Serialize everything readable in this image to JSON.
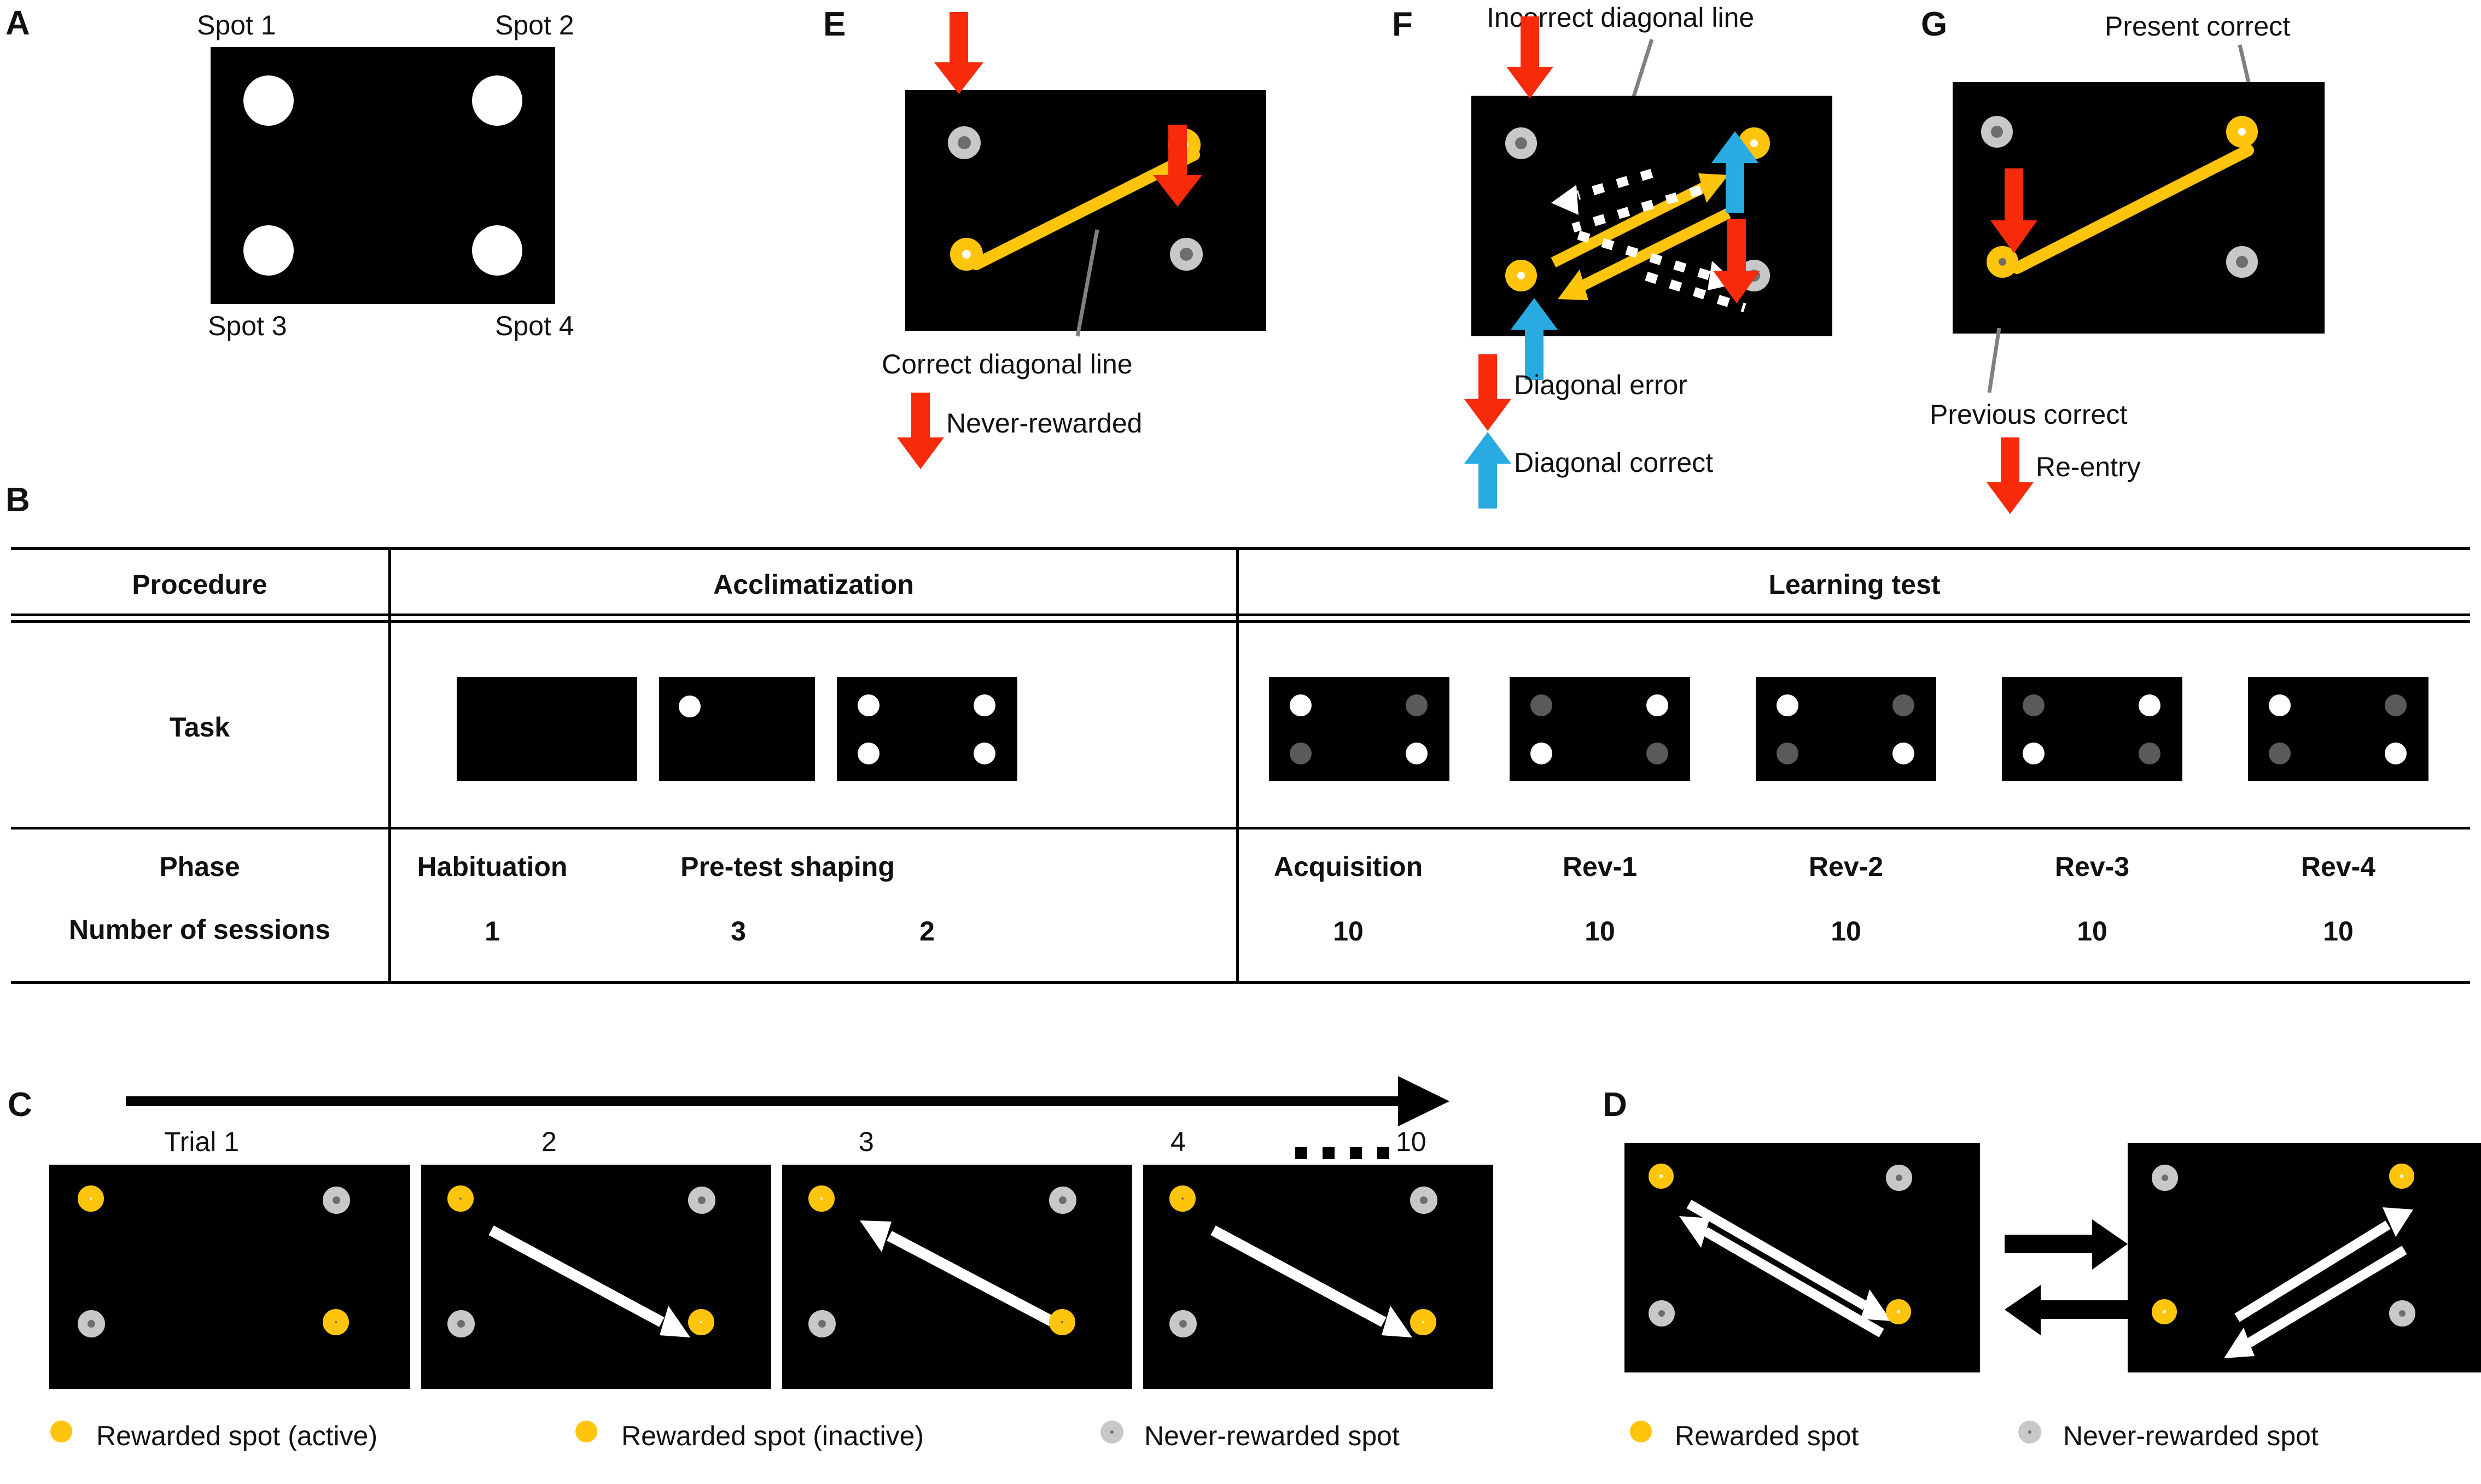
{
  "figure": {
    "panels": [
      "A",
      "B",
      "C",
      "D",
      "E",
      "F",
      "G"
    ]
  },
  "panelA": {
    "letter": "A",
    "spot_labels": [
      "Spot 1",
      "Spot 2",
      "Spot 3",
      "Spot 4"
    ],
    "spots": [
      {
        "name": "Spot 1",
        "position": "top-left",
        "fill": "white"
      },
      {
        "name": "Spot 2",
        "position": "top-right",
        "fill": "white"
      },
      {
        "name": "Spot 3",
        "position": "bottom-left",
        "fill": "white"
      },
      {
        "name": "Spot 4",
        "position": "bottom-right",
        "fill": "white"
      }
    ]
  },
  "panelB": {
    "letter": "B",
    "row_headers": [
      "Procedure",
      "Task",
      "Phase",
      "Number of sessions"
    ],
    "procedures": [
      {
        "name": "Acclimatization",
        "span": 3
      },
      {
        "name": "Learning test",
        "span": 5
      }
    ],
    "columns": [
      {
        "phase": "Habituation",
        "sessions": "1",
        "procedure": "Acclimatization",
        "task": "empty"
      },
      {
        "phase": "Pre-test shaping",
        "sessions": "3",
        "procedure": "Acclimatization",
        "task": "one-white-topleft"
      },
      {
        "phase": "",
        "sessions": "2",
        "procedure": "Acclimatization",
        "task": "four-white"
      },
      {
        "phase": "Acquisition",
        "sessions": "10",
        "procedure": "Learning test",
        "task": "diag-A"
      },
      {
        "phase": "Rev-1",
        "sessions": "10",
        "procedure": "Learning test",
        "task": "diag-B"
      },
      {
        "phase": "Rev-2",
        "sessions": "10",
        "procedure": "Learning test",
        "task": "diag-A"
      },
      {
        "phase": "Rev-3",
        "sessions": "10",
        "procedure": "Learning test",
        "task": "diag-B"
      },
      {
        "phase": "Rev-4",
        "sessions": "10",
        "procedure": "Learning test",
        "task": "diag-A"
      }
    ]
  },
  "panelC": {
    "letter": "C",
    "trial_labels": [
      "Trial 1",
      "2",
      "3",
      "4"
    ],
    "last_trial_label": "10",
    "ellipsis_dots": 4,
    "trials": [
      {
        "label": "Trial 1",
        "topleft": "active",
        "bottomright": "inactive",
        "arrow": "none"
      },
      {
        "label": "2",
        "topleft": "inactive",
        "bottomright": "active",
        "arrow": "tl-to-br"
      },
      {
        "label": "3",
        "topleft": "active",
        "bottomright": "inactive",
        "arrow": "br-to-tl"
      },
      {
        "label": "4",
        "topleft": "inactive",
        "bottomright": "active",
        "arrow": "tl-to-br"
      }
    ],
    "legend": [
      {
        "marker": "ring-white",
        "label": "Rewarded spot (active)"
      },
      {
        "marker": "ring-gray",
        "label": "Rewarded spot (inactive)"
      },
      {
        "marker": "gray-circle",
        "label": "Never-rewarded spot"
      }
    ]
  },
  "panelD": {
    "letter": "D",
    "boxes": [
      {
        "rewarded": [
          "top-left",
          "bottom-right"
        ],
        "arrow": "double-tl-br"
      },
      {
        "rewarded": [
          "top-right",
          "bottom-left"
        ],
        "arrow": "double-bl-tr"
      }
    ],
    "transition_arrows": [
      "right",
      "left"
    ],
    "legend": [
      {
        "marker": "ring-white",
        "label": "Rewarded spot"
      },
      {
        "marker": "gray-circle",
        "label": "Never-rewarded spot"
      }
    ]
  },
  "panelE": {
    "letter": "E",
    "callout": "Correct diagonal line",
    "legend": [
      {
        "marker": "red-arrow-down",
        "label": "Never-rewarded"
      }
    ],
    "spots": [
      {
        "position": "top-left",
        "type": "never-rewarded",
        "arrow": "red-down"
      },
      {
        "position": "top-right",
        "type": "rewarded-active"
      },
      {
        "position": "bottom-left",
        "type": "rewarded-active"
      },
      {
        "position": "bottom-right",
        "type": "never-rewarded",
        "arrow": "red-down"
      }
    ]
  },
  "panelF": {
    "letter": "F",
    "callout": "Incorrect diagonal line",
    "legend": [
      {
        "marker": "red-arrow-down",
        "label": "Diagonal error"
      },
      {
        "marker": "blue-arrow-up",
        "label": "Diagonal correct"
      }
    ],
    "spots": [
      {
        "position": "top-left",
        "type": "never-rewarded",
        "arrow": "red-down"
      },
      {
        "position": "top-right",
        "type": "rewarded-active",
        "arrow": "blue-up"
      },
      {
        "position": "bottom-left",
        "type": "rewarded-active",
        "arrow": "blue-up"
      },
      {
        "position": "bottom-right",
        "type": "never-rewarded",
        "arrow": "red-down"
      }
    ]
  },
  "panelG": {
    "letter": "G",
    "callouts": [
      "Present correct",
      "Previous correct"
    ],
    "legend": [
      {
        "marker": "red-arrow-down",
        "label": "Re-entry"
      }
    ],
    "spots": [
      {
        "position": "top-left",
        "type": "never-rewarded"
      },
      {
        "position": "top-right",
        "type": "present-correct"
      },
      {
        "position": "bottom-left",
        "type": "previous-correct",
        "arrow": "red-down"
      },
      {
        "position": "bottom-right",
        "type": "never-rewarded"
      }
    ]
  },
  "colors": {
    "yellow_ring": "#FFC40C",
    "red_arrow": "#F72A0A",
    "blue_arrow": "#29ABE2",
    "gray_outer": "#C8C8C8",
    "gray_inner": "#6E6E6E",
    "box_black": "#000000",
    "white": "#FFFFFF",
    "callout_line": "#808080"
  }
}
